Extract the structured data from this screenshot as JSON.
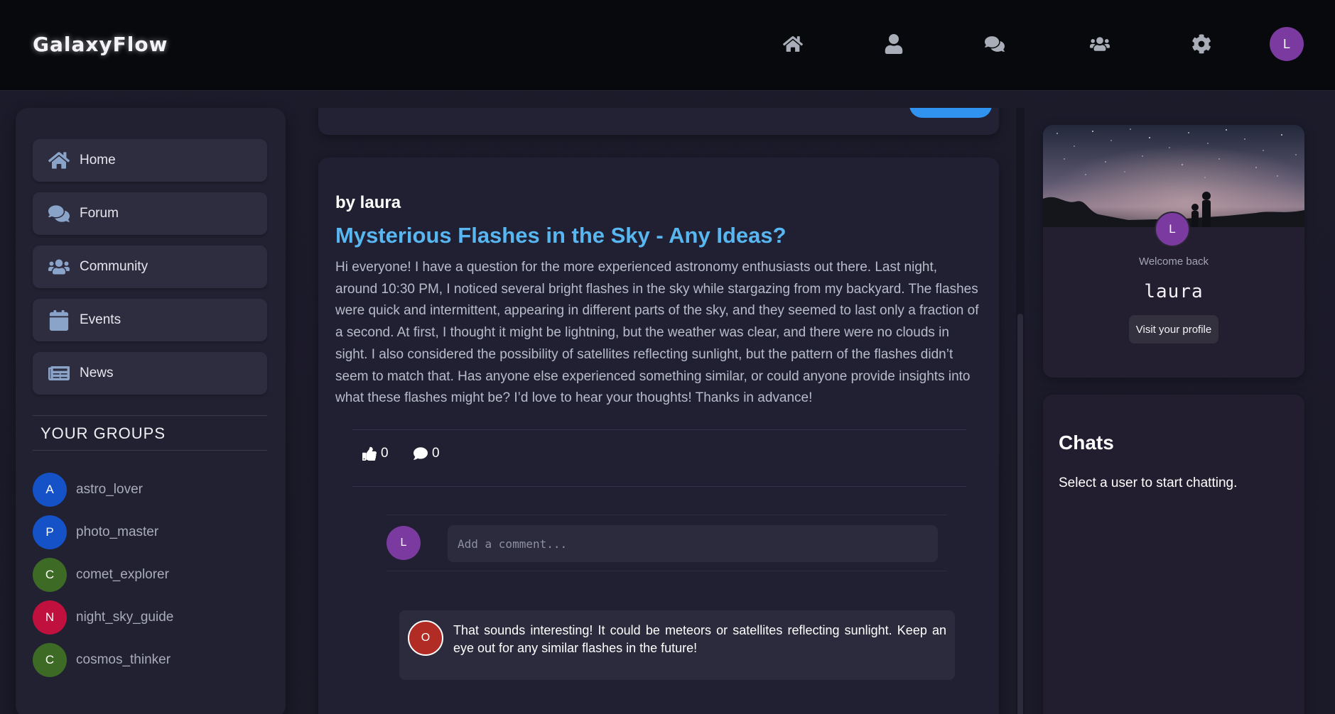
{
  "header": {
    "logo": "GalaxyFlow",
    "nav_icons": [
      "home-icon",
      "user-icon",
      "comments-icon",
      "users-icon",
      "gear-icon"
    ],
    "user_initial": "L"
  },
  "sidebar": {
    "items": [
      {
        "label": "Home",
        "icon": "home-icon"
      },
      {
        "label": "Forum",
        "icon": "comments-icon"
      },
      {
        "label": "Community",
        "icon": "users-icon"
      },
      {
        "label": "Events",
        "icon": "calendar-icon"
      },
      {
        "label": "News",
        "icon": "newspaper-icon"
      }
    ],
    "groups_title": "YOUR GROUPS",
    "groups": [
      {
        "initial": "A",
        "name": "astro_lover",
        "color": "#1552c8"
      },
      {
        "initial": "P",
        "name": "photo_master",
        "color": "#1552c8"
      },
      {
        "initial": "C",
        "name": "comet_explorer",
        "color": "#3d6b25"
      },
      {
        "initial": "N",
        "name": "night_sky_guide",
        "color": "#c0103e"
      },
      {
        "initial": "C",
        "name": "cosmos_thinker",
        "color": "#3d6b25"
      }
    ]
  },
  "post": {
    "author": "by laura",
    "title": "Mysterious Flashes in the Sky - Any Ideas?",
    "body": "Hi everyone! I have a question for the more experienced astronomy enthusiasts out there. Last night, around 10:30 PM, I noticed several bright flashes in the sky while stargazing from my backyard. The flashes were quick and intermittent, appearing in different parts of the sky, and they seemed to last only a fraction of a second. At first, I thought it might be lightning, but the weather was clear, and there were no clouds in sight. I also considered the possibility of satellites reflecting sunlight, but the pattern of the flashes didn’t seem to match that. Has anyone else experienced something similar, or could anyone provide insights into what these flashes might be? I’d love to hear your thoughts! Thanks in advance!",
    "likes": "0",
    "comments_count": "0",
    "comment_input": {
      "avatar_initial": "L",
      "placeholder": "Add a comment..."
    },
    "comments": [
      {
        "initial": "O",
        "text": "That sounds interesting! It could be meteors or satellites reflecting sunlight. Keep an eye out for any similar flashes in the future!"
      }
    ]
  },
  "profile": {
    "avatar_initial": "L",
    "welcome": "Welcome back",
    "username": "laura",
    "visit_button": "Visit your profile"
  },
  "chats": {
    "title": "Chats",
    "empty_message": "Select a user to start chatting."
  },
  "colors": {
    "accent": "#58b6f0",
    "primary_button": "#2f93ef",
    "user_avatar": "#7b3aa0"
  }
}
